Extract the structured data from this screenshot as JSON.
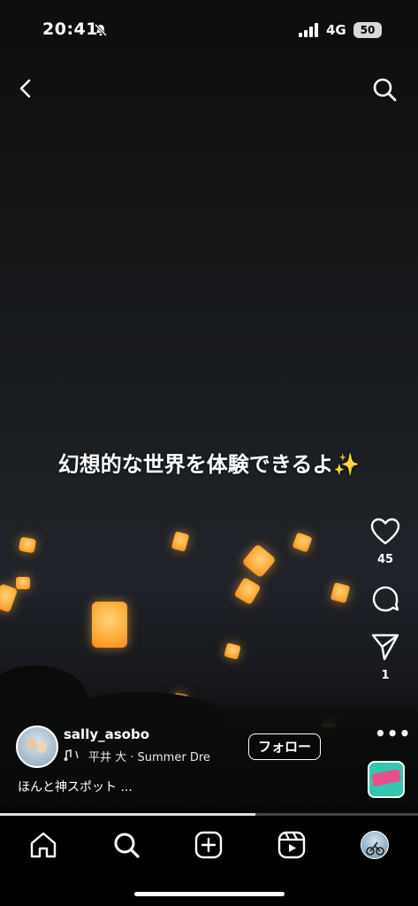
{
  "status_bar": {
    "time": "20:41",
    "network": "4G",
    "battery": "50"
  },
  "header": {
    "back_icon": "chevron-left-icon",
    "search_icon": "search-icon"
  },
  "overlay": {
    "caption": "幻想的な世界を体験できるよ✨"
  },
  "actions": {
    "like_count": "45",
    "share_count": "1",
    "more": "•••"
  },
  "post": {
    "username": "sally_asobo",
    "music_info": "平井 大 · Summer Dre",
    "follow_label": "フォロー",
    "description": "ほんと神スポット ..."
  },
  "playback": {
    "progress": 0.61
  },
  "nav": {
    "items": [
      "home",
      "search",
      "create",
      "reels",
      "profile"
    ]
  }
}
